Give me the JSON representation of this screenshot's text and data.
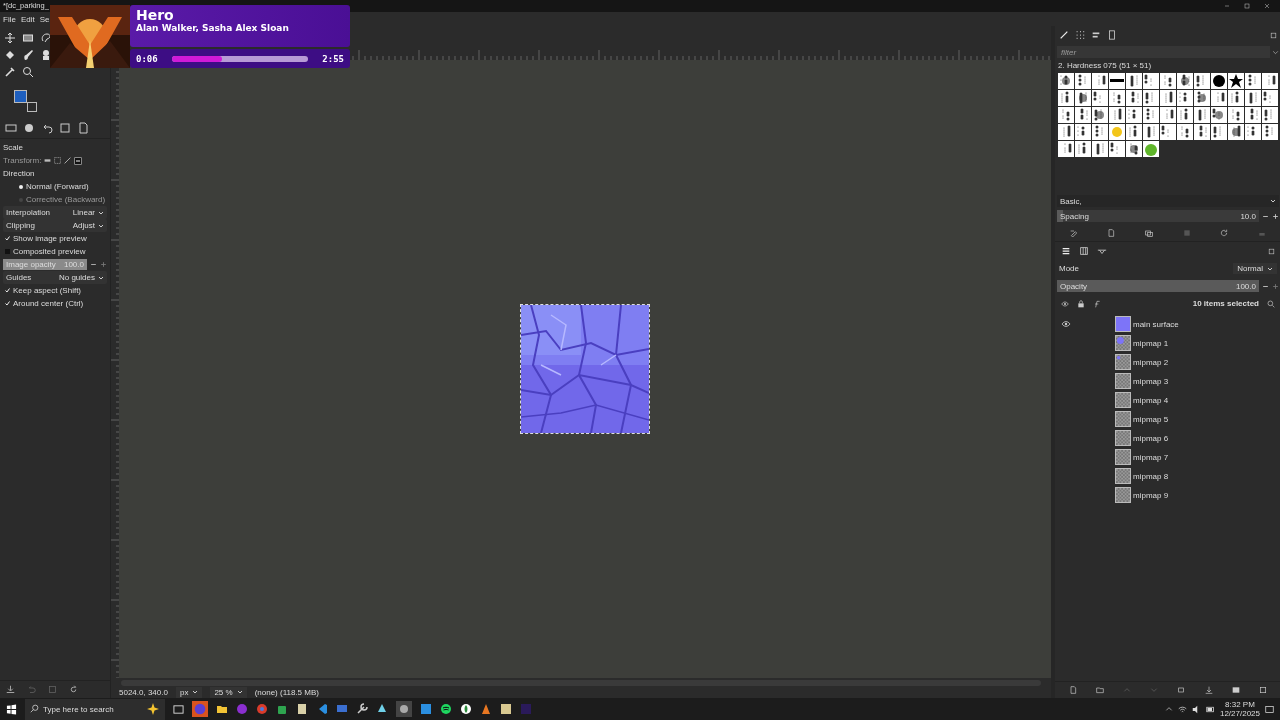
{
  "window": {
    "title": "*[dc_parking_"
  },
  "menu": [
    "File",
    "Edit",
    "Se"
  ],
  "now_playing": {
    "title": "Hero",
    "artist": "Alan Walker, Sasha Alex Sloan",
    "elapsed": "0:06",
    "level": 0.37,
    "duration": "2:55"
  },
  "tool_options": [
    {
      "kind": "heading",
      "label": "Scale"
    },
    {
      "kind": "icons",
      "label": "Transform:"
    },
    {
      "kind": "heading",
      "label": "Direction"
    },
    {
      "kind": "radio",
      "label": "Normal (Forward)",
      "selected": true
    },
    {
      "kind": "radio",
      "label": "Corrective (Backward)",
      "selected": false
    },
    {
      "kind": "dropdown",
      "label": "Interpolation",
      "value": "Linear"
    },
    {
      "kind": "dropdown",
      "label": "Clipping",
      "value": "Adjust"
    },
    {
      "kind": "checkbox",
      "label": "Show image preview",
      "checked": true
    },
    {
      "kind": "checkbox",
      "label": "Composited preview",
      "checked": false
    },
    {
      "kind": "slider",
      "label": "Image opacity",
      "value": "100.0",
      "level": 1
    },
    {
      "kind": "dropdown",
      "label": "Guides",
      "value": "No guides"
    },
    {
      "kind": "checkbox",
      "label": "Keep aspect (Shift)",
      "checked": true
    },
    {
      "kind": "checkbox",
      "label": "Around center (Ctrl)",
      "checked": true
    }
  ],
  "status_bar": {
    "coordinates": "5024.0, 340.0",
    "unit": "px",
    "zoom": "25 %",
    "info": "(none) (118.5 MB)"
  },
  "brushes": {
    "filter_placeholder": "filter",
    "brush_name": "2. Hardness 075 (51 × 51)",
    "preset": "Basic,",
    "spacing": {
      "label": "Spacing",
      "value": "10.0",
      "level": 0.03
    }
  },
  "layers": {
    "mode_label": "Mode",
    "mode": "Normal",
    "opacity": {
      "label": "Opacity",
      "value": "100.0",
      "level": 1
    },
    "selection_count": "10 items selected",
    "items": [
      {
        "name": "main surface",
        "visible": true,
        "kind": "filled"
      },
      {
        "name": "mipmap 1",
        "visible": false,
        "kind": "partial"
      },
      {
        "name": "mipmap 2",
        "visible": false,
        "kind": "dot"
      },
      {
        "name": "mipmap 3",
        "visible": false,
        "kind": "empty"
      },
      {
        "name": "mipmap 4",
        "visible": false,
        "kind": "empty"
      },
      {
        "name": "mipmap 5",
        "visible": false,
        "kind": "empty"
      },
      {
        "name": "mipmap 6",
        "visible": false,
        "kind": "empty"
      },
      {
        "name": "mipmap 7",
        "visible": false,
        "kind": "empty"
      },
      {
        "name": "mipmap 8",
        "visible": false,
        "kind": "empty"
      },
      {
        "name": "mipmap 9",
        "visible": false,
        "kind": "empty"
      }
    ]
  },
  "taskbar": {
    "search_placeholder": "Type here to search",
    "time": "8:32 PM",
    "date": "12/27/2025"
  }
}
